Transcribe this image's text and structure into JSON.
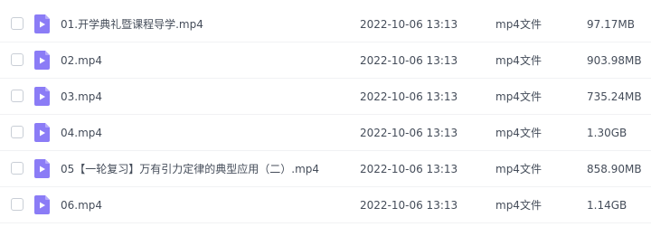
{
  "files": [
    {
      "name": "01.开学典礼暨课程导学.mp4",
      "modified": "2022-10-06 13:13",
      "type": "mp4文件",
      "size": "97.17MB",
      "icon": "video-file-icon"
    },
    {
      "name": "02.mp4",
      "modified": "2022-10-06 13:13",
      "type": "mp4文件",
      "size": "903.98MB",
      "icon": "video-file-icon"
    },
    {
      "name": "03.mp4",
      "modified": "2022-10-06 13:13",
      "type": "mp4文件",
      "size": "735.24MB",
      "icon": "video-file-icon"
    },
    {
      "name": "04.mp4",
      "modified": "2022-10-06 13:13",
      "type": "mp4文件",
      "size": "1.30GB",
      "icon": "video-file-icon"
    },
    {
      "name": "05【一轮复习】万有引力定律的典型应用（二）.mp4",
      "modified": "2022-10-06 13:13",
      "type": "mp4文件",
      "size": "858.90MB",
      "icon": "video-file-icon"
    },
    {
      "name": "06.mp4",
      "modified": "2022-10-06 13:13",
      "type": "mp4文件",
      "size": "1.14GB",
      "icon": "video-file-icon"
    }
  ],
  "colors": {
    "icon_bg": "#8b7cf6",
    "icon_fold": "#b5a9fb",
    "text": "#454d5a",
    "row_divider": "#f1f2f4"
  }
}
